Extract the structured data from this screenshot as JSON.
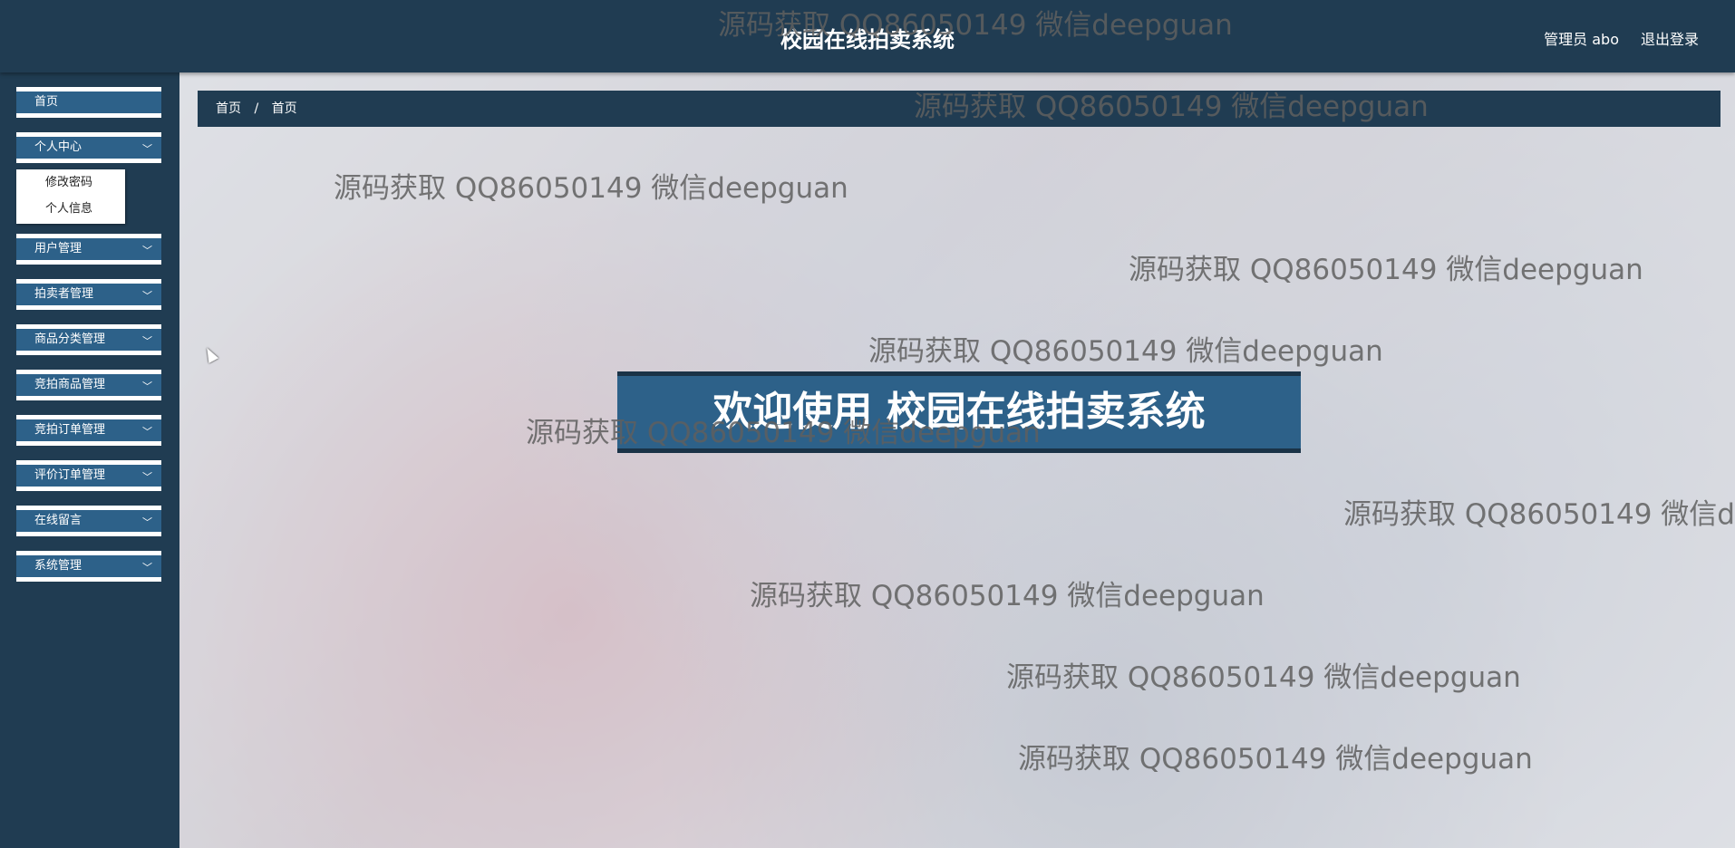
{
  "header": {
    "title": "校园在线拍卖系统",
    "user_label": "管理员 abo",
    "logout_label": "退出登录"
  },
  "sidebar": {
    "items": [
      {
        "label": "首页",
        "has_chevron": false
      },
      {
        "label": "个人中心",
        "has_chevron": true,
        "expanded": true
      },
      {
        "label": "用户管理",
        "has_chevron": true
      },
      {
        "label": "拍卖者管理",
        "has_chevron": true
      },
      {
        "label": "商品分类管理",
        "has_chevron": true
      },
      {
        "label": "竞拍商品管理",
        "has_chevron": true
      },
      {
        "label": "竞拍订单管理",
        "has_chevron": true
      },
      {
        "label": "评价订单管理",
        "has_chevron": true
      },
      {
        "label": "在线留言",
        "has_chevron": true
      },
      {
        "label": "系统管理",
        "has_chevron": true
      }
    ],
    "submenu": [
      "修改密码",
      "个人信息"
    ]
  },
  "breadcrumb": [
    "首页",
    "首页"
  ],
  "breadcrumb_separator": "/",
  "welcome_banner": "欢迎使用 校园在线拍卖系统",
  "watermark": "源码获取 QQ86050149 微信deepguan",
  "colors": {
    "header_bg": "#203c52",
    "accent_blue": "#2d6189"
  }
}
